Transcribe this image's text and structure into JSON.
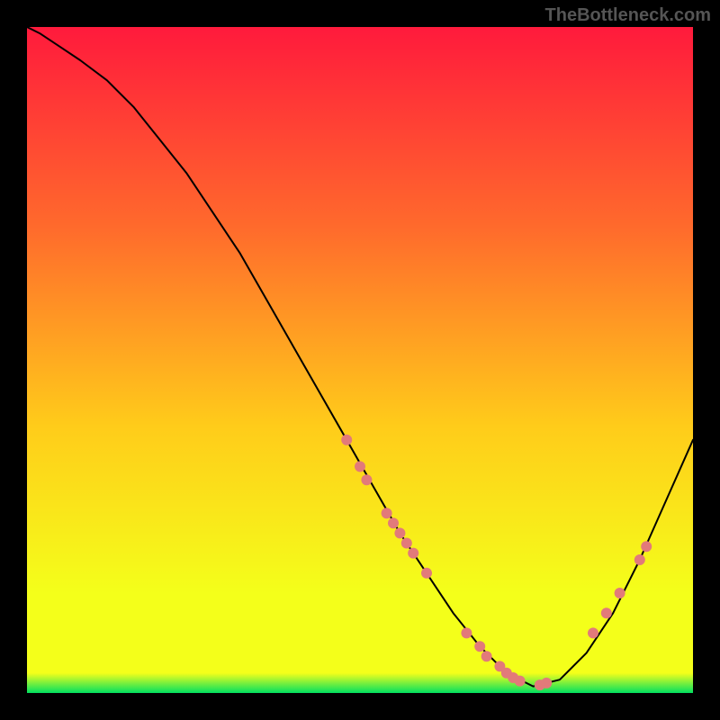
{
  "watermark": "TheBottleneck.com",
  "chart_data": {
    "type": "line",
    "title": "",
    "xlabel": "",
    "ylabel": "",
    "xlim": [
      0,
      100
    ],
    "ylim": [
      0,
      100
    ],
    "background_gradient": {
      "top": "#ff1a3c",
      "q1": "#ff6a2c",
      "mid": "#ffcc1a",
      "q3": "#f4ff1a",
      "bottom": "#00e060"
    },
    "series": [
      {
        "name": "bottleneck-curve",
        "color": "#000000",
        "stroke_width": 2,
        "x": [
          0,
          2,
          5,
          8,
          12,
          16,
          20,
          24,
          28,
          32,
          36,
          40,
          44,
          48,
          52,
          56,
          60,
          64,
          68,
          72,
          76,
          80,
          84,
          88,
          92,
          96,
          100
        ],
        "y": [
          100,
          99,
          97,
          95,
          92,
          88,
          83,
          78,
          72,
          66,
          59,
          52,
          45,
          38,
          31,
          24,
          18,
          12,
          7,
          3,
          1,
          2,
          6,
          12,
          20,
          29,
          38
        ]
      }
    ],
    "markers": {
      "name": "highlight-dots",
      "color": "#e27a7a",
      "radius": 6,
      "points": [
        {
          "x": 48,
          "y": 38
        },
        {
          "x": 50,
          "y": 34
        },
        {
          "x": 51,
          "y": 32
        },
        {
          "x": 54,
          "y": 27
        },
        {
          "x": 55,
          "y": 25.5
        },
        {
          "x": 56,
          "y": 24
        },
        {
          "x": 57,
          "y": 22.5
        },
        {
          "x": 58,
          "y": 21
        },
        {
          "x": 60,
          "y": 18
        },
        {
          "x": 66,
          "y": 9
        },
        {
          "x": 68,
          "y": 7
        },
        {
          "x": 69,
          "y": 5.5
        },
        {
          "x": 71,
          "y": 4
        },
        {
          "x": 72,
          "y": 3
        },
        {
          "x": 73,
          "y": 2.3
        },
        {
          "x": 74,
          "y": 1.8
        },
        {
          "x": 77,
          "y": 1.2
        },
        {
          "x": 78,
          "y": 1.5
        },
        {
          "x": 85,
          "y": 9
        },
        {
          "x": 87,
          "y": 12
        },
        {
          "x": 89,
          "y": 15
        },
        {
          "x": 92,
          "y": 20
        },
        {
          "x": 93,
          "y": 22
        }
      ]
    }
  }
}
